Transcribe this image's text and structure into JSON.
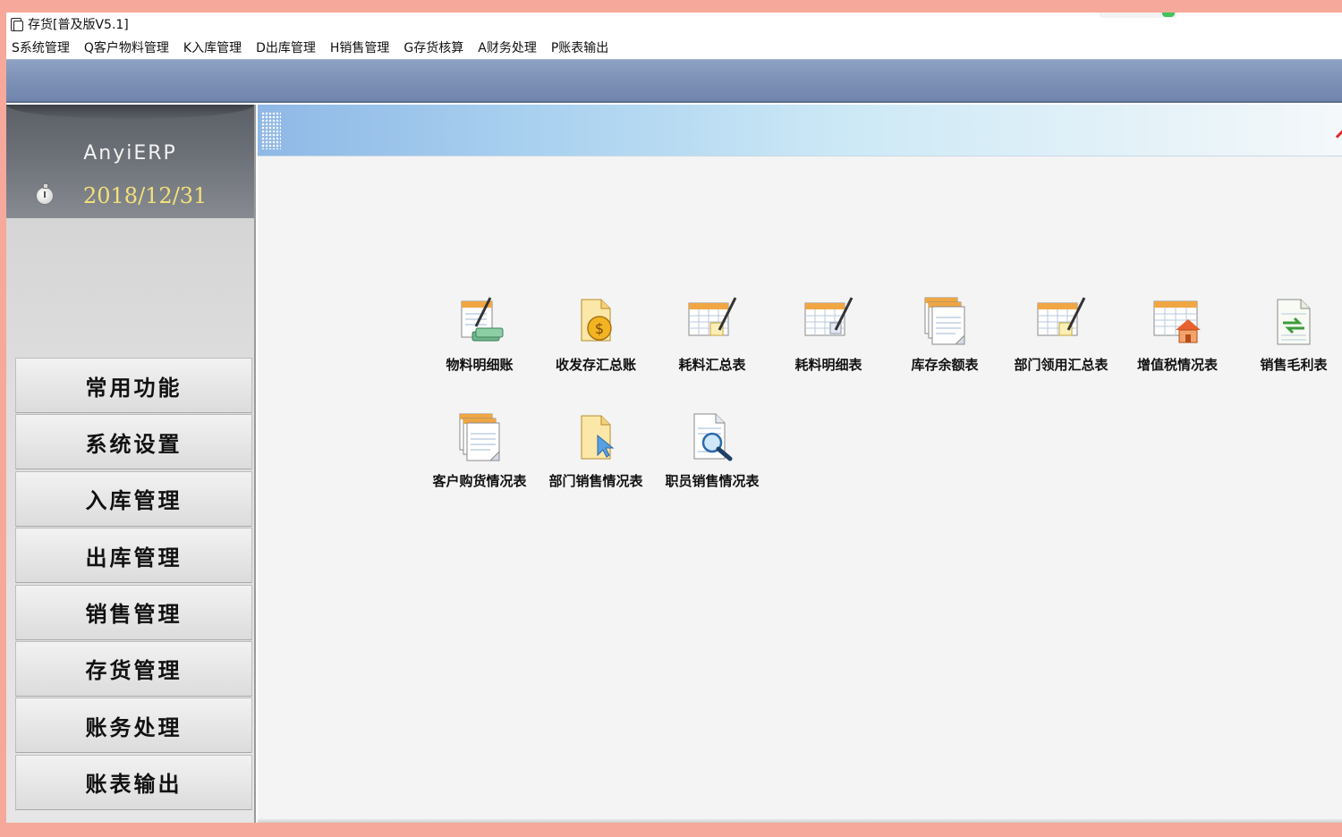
{
  "window": {
    "title": "存货[普及版V5.1]"
  },
  "menubar": {
    "items": [
      "S系统管理",
      "Q客户物料管理",
      "K入库管理",
      "D出库管理",
      "H销售管理",
      "G存货核算",
      "A财务处理",
      "P账表输出"
    ]
  },
  "sidebar": {
    "brand": "AnyiERP",
    "date": "2018/12/31",
    "nav": [
      "常用功能",
      "系统设置",
      "入库管理",
      "出库管理",
      "销售管理",
      "存货管理",
      "账务处理",
      "账表输出"
    ]
  },
  "content": {
    "functions": [
      {
        "label": "物料明细账",
        "icon": "ledger-pen-icon"
      },
      {
        "label": "收发存汇总账",
        "icon": "coin-document-icon"
      },
      {
        "label": "耗料汇总表",
        "icon": "calendar-pen-icon"
      },
      {
        "label": "耗料明细表",
        "icon": "calendar-pen-icon"
      },
      {
        "label": "库存余额表",
        "icon": "stacked-documents-icon"
      },
      {
        "label": "部门领用汇总表",
        "icon": "calendar-pen-icon"
      },
      {
        "label": "增值税情况表",
        "icon": "calendar-house-icon"
      },
      {
        "label": "销售毛利表",
        "icon": "document-exchange-icon"
      },
      {
        "label": "客户购货情况表",
        "icon": "stacked-documents-icon"
      },
      {
        "label": "部门销售情况表",
        "icon": "document-arrow-icon"
      },
      {
        "label": "职员销售情况表",
        "icon": "document-magnifier-icon"
      }
    ]
  },
  "colors": {
    "page_border": "#f6a99a",
    "toolbar_band": "#7f93b8",
    "date_text": "#f3e07a",
    "header_gradient_start": "#8fb8e6"
  }
}
